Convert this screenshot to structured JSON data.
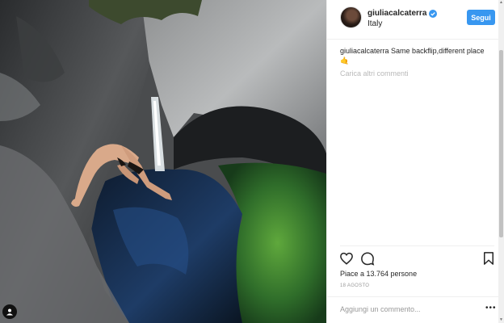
{
  "post": {
    "image_alt": "Woman doing a backflip into a rocky gorge pool with a waterfall",
    "username": "giuliacalcaterra",
    "verified": true,
    "location": "Italy",
    "follow_label": "Segui"
  },
  "caption": {
    "username": "giuliacalcaterra",
    "text": "Same backflip,different place🤙"
  },
  "load_more_label": "Carica altri commenti",
  "likes_text": "Piace a 13.764 persone",
  "date_text": "18 AGOSTO",
  "comment": {
    "placeholder": "Aggiungi un commento..."
  },
  "more_label": "•••",
  "colors": {
    "accent": "#3897f0",
    "text": "#262626",
    "muted": "#999999",
    "divider": "#efefef"
  },
  "icons": [
    "verified-badge-icon",
    "heart-icon",
    "comment-icon",
    "bookmark-icon",
    "more-options-icon"
  ]
}
